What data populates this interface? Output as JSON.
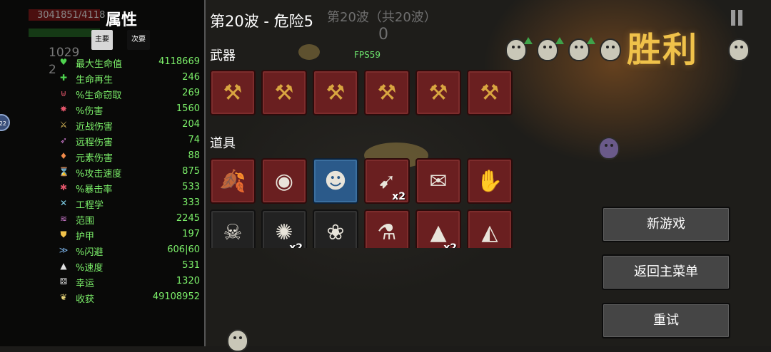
{
  "background_hud": {
    "hp_text": "3041851/4118",
    "materials_text": "1029",
    "other_text": "2"
  },
  "stats": {
    "title": "属性",
    "tabs": [
      "主要",
      "次要"
    ],
    "rows": [
      {
        "label": "最大生命值",
        "value": "4118669",
        "icon": "heart-icon",
        "glyph": "♥",
        "color": "#4fd34f"
      },
      {
        "label": "生命再生",
        "value": "246",
        "icon": "heart-regen-icon",
        "glyph": "✚",
        "color": "#4fd34f"
      },
      {
        "label": "%生命窃取",
        "value": "269",
        "icon": "lifesteal-icon",
        "glyph": "⊌",
        "color": "#e0556a"
      },
      {
        "label": "%伤害",
        "value": "1560",
        "icon": "damage-icon",
        "glyph": "✸",
        "color": "#e0556a"
      },
      {
        "label": "近战伤害",
        "value": "204",
        "icon": "melee-sword-icon",
        "glyph": "⚔",
        "color": "#e7c45e"
      },
      {
        "label": "远程伤害",
        "value": "74",
        "icon": "ranged-bow-icon",
        "glyph": "➶",
        "color": "#cf7bd0"
      },
      {
        "label": "元素伤害",
        "value": "88",
        "icon": "elemental-flame-icon",
        "glyph": "♦",
        "color": "#f08a4a"
      },
      {
        "label": "%攻击速度",
        "value": "875",
        "icon": "hourglass-icon",
        "glyph": "⌛",
        "color": "#e0e0e0"
      },
      {
        "label": "%暴击率",
        "value": "533",
        "icon": "crit-icon",
        "glyph": "✱",
        "color": "#e0556a"
      },
      {
        "label": "工程学",
        "value": "333",
        "icon": "engineering-wrench-icon",
        "glyph": "✕",
        "color": "#7fd0e8"
      },
      {
        "label": "范围",
        "value": "2245",
        "icon": "range-wifi-icon",
        "glyph": "≋",
        "color": "#cf7bd0"
      },
      {
        "label": "护甲",
        "value": "197",
        "icon": "armor-shield-icon",
        "glyph": "⛊",
        "color": "#f0c24a"
      },
      {
        "label": "%闪避",
        "value": "606|60",
        "icon": "dodge-icon",
        "glyph": "≫",
        "color": "#7fb8f0"
      },
      {
        "label": "%速度",
        "value": "531",
        "icon": "speed-boot-icon",
        "glyph": "▲",
        "color": "#e0e0e0"
      },
      {
        "label": "幸运",
        "value": "1320",
        "icon": "luck-dice-icon",
        "glyph": "⚄",
        "color": "#e0e0e0"
      },
      {
        "label": "收获",
        "value": "49108952",
        "icon": "harvest-icon",
        "glyph": "❦",
        "color": "#e7d47a"
      }
    ]
  },
  "inventory": {
    "wave_title": "第20波 - 危险5",
    "wave_ghost": "第20波（共20波）",
    "wave_ghost_num": "0",
    "fps": "FPS59",
    "weapons_label": "武器",
    "items_label": "道具",
    "weapons": [
      {
        "name": "crossbow-weapon-icon",
        "glyph": "⚒"
      },
      {
        "name": "crossbow-weapon-icon",
        "glyph": "⚒"
      },
      {
        "name": "crossbow-weapon-icon",
        "glyph": "⚒"
      },
      {
        "name": "crossbow-weapon-icon",
        "glyph": "⚒"
      },
      {
        "name": "crossbow-weapon-icon",
        "glyph": "⚒"
      },
      {
        "name": "crossbow-weapon-icon",
        "glyph": "⚒"
      }
    ],
    "items": [
      {
        "name": "rainbow-leaf-item-icon",
        "glyph": "🍂",
        "color": "red",
        "count": ""
      },
      {
        "name": "stomach-item-icon",
        "glyph": "◉",
        "color": "red",
        "count": ""
      },
      {
        "name": "ninja-item-icon",
        "glyph": "☻",
        "color": "blue",
        "count": ""
      },
      {
        "name": "rocket-item-icon",
        "glyph": "➹",
        "color": "red",
        "count": "x2"
      },
      {
        "name": "scroll-item-icon",
        "glyph": "✉",
        "color": "red",
        "count": ""
      },
      {
        "name": "bloody-hand-item-icon",
        "glyph": "✋",
        "color": "red",
        "count": ""
      },
      {
        "name": "skull-item-icon",
        "glyph": "☠",
        "color": "black",
        "count": ""
      },
      {
        "name": "hedgehog-item-icon",
        "glyph": "✺",
        "color": "black",
        "count": "x2"
      },
      {
        "name": "butterfly-item-icon",
        "glyph": "❀",
        "color": "black",
        "count": ""
      },
      {
        "name": "potion-vial-item-icon",
        "glyph": "⚗",
        "color": "red",
        "count": ""
      },
      {
        "name": "red-cape-item-icon",
        "glyph": "▲",
        "color": "red",
        "count": "x2"
      },
      {
        "name": "wolf-head-item-icon",
        "glyph": "◭",
        "color": "red",
        "count": ""
      }
    ]
  },
  "result": {
    "victory_text": "胜利",
    "buttons": {
      "new_game": "新游戏",
      "main_menu": "返回主菜单",
      "retry": "重试"
    }
  }
}
